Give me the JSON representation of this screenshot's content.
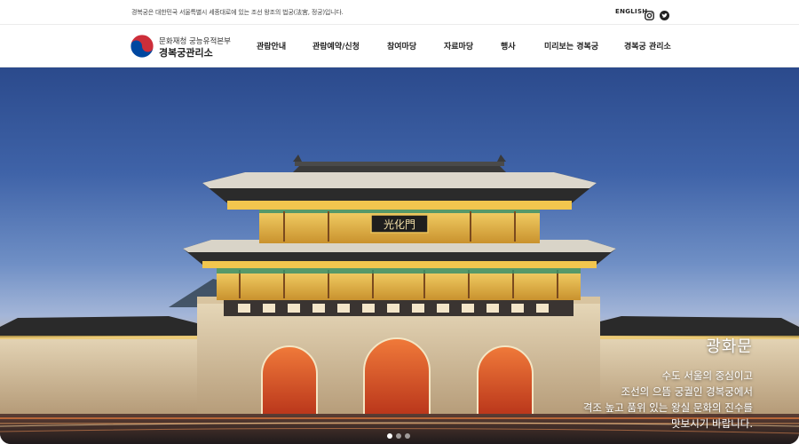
{
  "topbar": {
    "notice": "경복궁은 대한민국 서울특별시 세종대로에 있는 조선 왕조의 법궁(法宮, 정궁)입니다.",
    "language_link": "ENGLISH",
    "sns": [
      "instagram-icon",
      "twitter-icon"
    ]
  },
  "header": {
    "logo_sub": "문화재청 궁능유적본부",
    "logo_main": "경복궁관리소",
    "nav": [
      {
        "label": "관람안내"
      },
      {
        "label": "관람예약/신청"
      },
      {
        "label": "참여마당"
      },
      {
        "label": "자료마당"
      },
      {
        "label": "행사"
      },
      {
        "label": "미리보는 경복궁"
      },
      {
        "label": "경복궁 관리소"
      }
    ]
  },
  "hero": {
    "gate_plaque": "光化門",
    "title": "광화문",
    "lines": [
      "수도 서울의 중심이고",
      "조선의 으뜸 궁궐인 경복궁에서",
      "격조 높고 품위 있는 왕실 문화의 진수를",
      "맛보시기 바랍니다."
    ]
  },
  "slider": {
    "total": 3,
    "active": 1
  },
  "colors": {
    "sky_top": "#2b4a8c",
    "wall": "#d8c8a8",
    "arch_glow": "#e0562a",
    "roof": "#2d2d2d",
    "logo_red": "#cd2e3a",
    "logo_blue": "#0047a0"
  }
}
